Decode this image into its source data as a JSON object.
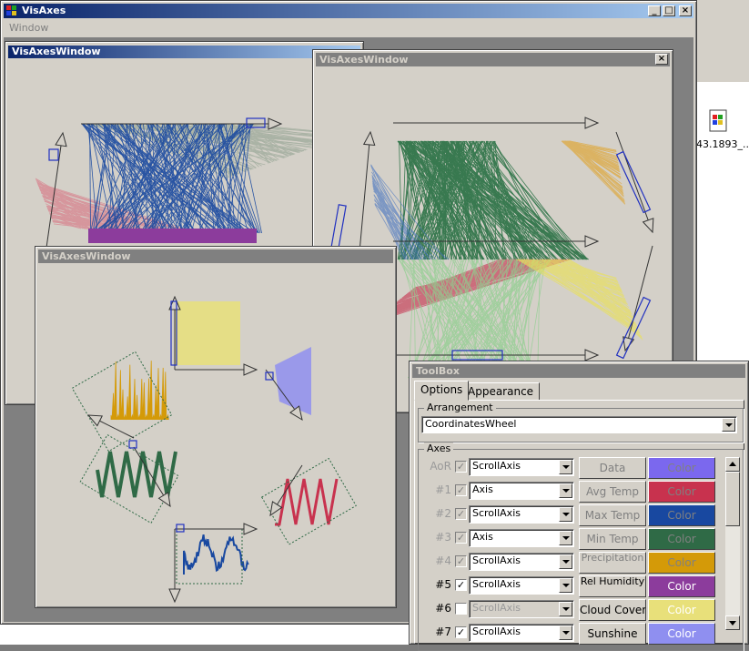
{
  "desktop": {
    "file_label": "43.1893_..."
  },
  "main_window": {
    "title": "VisAxes",
    "menu": [
      "Window"
    ]
  },
  "windows": {
    "left": {
      "title": "VisAxesWindow"
    },
    "right": {
      "title": "VisAxesWindow"
    },
    "bottom": {
      "title": "VisAxesWindow"
    }
  },
  "toolbox": {
    "title": "ToolBox",
    "tabs": [
      "Options",
      "Appearance"
    ],
    "arrangement_label": "Arrangement",
    "arrangement_value": "CoordinatesWheel",
    "axes_label": "Axes",
    "rows": [
      {
        "id": "AoR",
        "checked": true,
        "enabled": false,
        "type": "ScrollAxis",
        "type_enabled": true,
        "data": "Data",
        "color": "#7b68ee",
        "color_label": "Color"
      },
      {
        "id": "#1",
        "checked": true,
        "enabled": false,
        "type": "Axis",
        "type_enabled": true,
        "data": "Avg Temp",
        "color": "#c8324e",
        "color_label": "Color"
      },
      {
        "id": "#2",
        "checked": true,
        "enabled": false,
        "type": "ScrollAxis",
        "type_enabled": true,
        "data": "Max Temp",
        "color": "#1848a0",
        "color_label": "Color"
      },
      {
        "id": "#3",
        "checked": true,
        "enabled": false,
        "type": "Axis",
        "type_enabled": true,
        "data": "Min Temp",
        "color": "#2f6a46",
        "color_label": "Color"
      },
      {
        "id": "#4",
        "checked": true,
        "enabled": false,
        "type": "ScrollAxis",
        "type_enabled": true,
        "data": "Precipitation",
        "color": "#d49a08",
        "color_label": "Color"
      },
      {
        "id": "#5",
        "checked": true,
        "enabled": true,
        "type": "ScrollAxis",
        "type_enabled": true,
        "data": "Rel Humidity",
        "color": "#8c3c9c",
        "color_label": "Color"
      },
      {
        "id": "#6",
        "checked": false,
        "enabled": true,
        "type": "ScrollAxis",
        "type_enabled": false,
        "data": "Cloud Cover",
        "color": "#e8e07a",
        "color_label": "Color"
      },
      {
        "id": "#7",
        "checked": true,
        "enabled": true,
        "type": "ScrollAxis",
        "type_enabled": true,
        "data": "Sunshine",
        "color": "#8f8ff0",
        "color_label": "Color"
      }
    ]
  },
  "colors": {
    "active_title": "#0a246a",
    "inactive_title": "#808080",
    "face": "#d4d0c8"
  }
}
